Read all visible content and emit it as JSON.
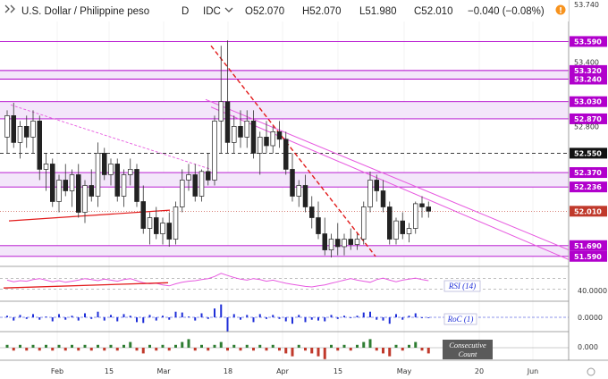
{
  "header": {
    "symbol": "U.S. Dollar / Philippine peso",
    "interval": "D",
    "exchange": "IDC",
    "open": "O52.070",
    "high": "H52.070",
    "low": "L51.980",
    "close": "C52.010",
    "change": "−0.040 (−0.08%)",
    "chevron_icon": "chevron-down-icon",
    "alert_icon": "exclamation-badge-icon"
  },
  "colors": {
    "bull": "#2e7d32",
    "bear": "#c0392b",
    "zone_fill": "#f3e6fa",
    "zone_line": "#b100cc",
    "channel": "#e75ae0",
    "trend_red": "#e21b1b",
    "price_tag": "#222222",
    "rsi_line": "#e75ae0",
    "roc_bar": "#1f2fd8"
  },
  "chart_data": {
    "type": "candlestick",
    "title": "U.S. Dollar / Philippine peso",
    "x_labels": [
      "Feb",
      "15",
      "Mar",
      "18",
      "Apr",
      "15",
      "May",
      "20",
      "Jun"
    ],
    "y_labels": [
      "53.740",
      "53.590",
      "53.400",
      "53.320",
      "53.240",
      "53.030",
      "52.870",
      "52.800",
      "52.550",
      "52.370",
      "52.236",
      "52.010",
      "51.690",
      "51.590"
    ],
    "ylim": [
      51.48,
      53.76
    ],
    "last_price": 52.01,
    "ohlc": [
      [
        52.7,
        52.95,
        52.55,
        52.9
      ],
      [
        52.9,
        53.02,
        52.6,
        52.65
      ],
      [
        52.65,
        52.85,
        52.5,
        52.8
      ],
      [
        52.8,
        52.9,
        52.6,
        52.7
      ],
      [
        52.7,
        52.95,
        52.55,
        52.85
      ],
      [
        52.85,
        52.9,
        52.3,
        52.4
      ],
      [
        52.4,
        52.55,
        52.2,
        52.45
      ],
      [
        52.45,
        52.5,
        52.05,
        52.1
      ],
      [
        52.1,
        52.35,
        52.0,
        52.3
      ],
      [
        52.3,
        52.45,
        52.15,
        52.2
      ],
      [
        52.2,
        52.4,
        52.05,
        52.35
      ],
      [
        52.35,
        52.45,
        51.95,
        52.0
      ],
      [
        52.0,
        52.3,
        51.9,
        52.25
      ],
      [
        52.25,
        52.4,
        52.1,
        52.15
      ],
      [
        52.15,
        52.65,
        52.05,
        52.55
      ],
      [
        52.55,
        52.6,
        52.3,
        52.35
      ],
      [
        52.35,
        52.5,
        52.25,
        52.45
      ],
      [
        52.45,
        52.5,
        52.1,
        52.15
      ],
      [
        52.15,
        52.4,
        52.05,
        52.35
      ],
      [
        52.35,
        52.5,
        52.25,
        52.4
      ],
      [
        52.4,
        52.45,
        52.05,
        52.1
      ],
      [
        52.1,
        52.25,
        51.8,
        51.85
      ],
      [
        51.85,
        52.0,
        51.7,
        51.95
      ],
      [
        51.95,
        52.05,
        51.75,
        51.8
      ],
      [
        51.8,
        51.95,
        51.7,
        51.9
      ],
      [
        51.9,
        52.0,
        51.68,
        51.75
      ],
      [
        51.75,
        52.1,
        51.7,
        52.05
      ],
      [
        52.05,
        52.4,
        52.0,
        52.3
      ],
      [
        52.3,
        52.45,
        52.2,
        52.35
      ],
      [
        52.35,
        52.45,
        52.1,
        52.15
      ],
      [
        52.15,
        52.4,
        52.1,
        52.38
      ],
      [
        52.38,
        52.55,
        52.25,
        52.3
      ],
      [
        52.3,
        52.9,
        52.25,
        52.85
      ],
      [
        52.85,
        53.55,
        52.55,
        53.03
      ],
      [
        53.03,
        53.6,
        52.55,
        52.65
      ],
      [
        52.65,
        52.9,
        52.55,
        52.8
      ],
      [
        52.8,
        52.95,
        52.6,
        52.7
      ],
      [
        52.7,
        52.95,
        52.6,
        52.85
      ],
      [
        52.85,
        52.95,
        52.5,
        52.55
      ],
      [
        52.55,
        52.75,
        52.35,
        52.7
      ],
      [
        52.7,
        52.85,
        52.55,
        52.62
      ],
      [
        52.62,
        52.8,
        52.55,
        52.75
      ],
      [
        52.75,
        52.85,
        52.6,
        52.68
      ],
      [
        52.68,
        52.75,
        52.35,
        52.4
      ],
      [
        52.4,
        52.55,
        52.1,
        52.15
      ],
      [
        52.15,
        52.3,
        52.05,
        52.25
      ],
      [
        52.25,
        52.35,
        52.0,
        52.05
      ],
      [
        52.05,
        52.15,
        51.85,
        51.95
      ],
      [
        51.95,
        52.1,
        51.75,
        51.8
      ],
      [
        51.8,
        51.95,
        51.6,
        51.65
      ],
      [
        51.65,
        51.8,
        51.58,
        51.75
      ],
      [
        51.75,
        51.9,
        51.6,
        51.68
      ],
      [
        51.68,
        51.8,
        51.6,
        51.75
      ],
      [
        51.75,
        51.85,
        51.65,
        51.7
      ],
      [
        51.7,
        51.8,
        51.65,
        51.75
      ],
      [
        51.75,
        52.1,
        51.7,
        52.05
      ],
      [
        52.05,
        52.38,
        52.0,
        52.3
      ],
      [
        52.3,
        52.35,
        52.1,
        52.2
      ],
      [
        52.2,
        52.3,
        52.0,
        52.05
      ],
      [
        52.05,
        52.1,
        51.7,
        51.75
      ],
      [
        51.75,
        51.95,
        51.7,
        51.92
      ],
      [
        51.92,
        52.0,
        51.75,
        51.8
      ],
      [
        51.8,
        51.9,
        51.72,
        51.85
      ],
      [
        51.85,
        52.1,
        51.8,
        52.08
      ],
      [
        52.08,
        52.15,
        51.95,
        52.05
      ],
      [
        52.05,
        52.1,
        51.95,
        52.01
      ]
    ],
    "horizontal_levels": [
      53.59,
      53.32,
      53.24,
      53.03,
      52.87,
      52.37,
      52.236,
      51.69,
      51.59
    ],
    "dashed_level": 52.55,
    "zones": [
      [
        53.24,
        53.32
      ],
      [
        52.87,
        53.03
      ],
      [
        52.236,
        52.37
      ],
      [
        51.59,
        51.69
      ]
    ],
    "indicators": [
      {
        "name": "RSI (14)",
        "level_label": "40.0000",
        "values": [
          57,
          54,
          56,
          55,
          58,
          60,
          57,
          54,
          56,
          53,
          55,
          57,
          60,
          58,
          56,
          59,
          57,
          55,
          58,
          60,
          56,
          52,
          50,
          51,
          48,
          46,
          50,
          53,
          55,
          56,
          58,
          60,
          64,
          70,
          66,
          62,
          59,
          57,
          60,
          58,
          55,
          57,
          54,
          51,
          49,
          47,
          45,
          44,
          46,
          48,
          51,
          54,
          57,
          60,
          57,
          55,
          53,
          58,
          61,
          57,
          54,
          57,
          59,
          61,
          58,
          56
        ]
      },
      {
        "name": "RoC (1)",
        "level_label": "0.0000",
        "values": [
          2,
          -4,
          3,
          -2,
          4,
          -3,
          1,
          -5,
          4,
          -3,
          2,
          -4,
          5,
          -2,
          7,
          -4,
          3,
          -5,
          4,
          2,
          -6,
          -7,
          3,
          -4,
          2,
          -3,
          7,
          6,
          1,
          -4,
          5,
          -2,
          11,
          16,
          -18,
          4,
          -3,
          3,
          -6,
          4,
          -2,
          3,
          -2,
          -5,
          -8,
          3,
          -6,
          -3,
          -4,
          -5,
          3,
          -2,
          2,
          -1,
          2,
          6,
          7,
          -3,
          -4,
          -8,
          4,
          -3,
          2,
          5,
          -1,
          -1
        ]
      },
      {
        "name": "Consecutive Count",
        "level_label": "0.000",
        "values": [
          1,
          -1,
          1,
          -1,
          1,
          -1,
          1,
          -1,
          1,
          -1,
          1,
          -1,
          1,
          -1,
          1,
          -1,
          1,
          -1,
          1,
          2,
          -1,
          -2,
          1,
          -1,
          1,
          -1,
          1,
          2,
          3,
          -1,
          1,
          -1,
          1,
          2,
          -1,
          1,
          -1,
          1,
          -1,
          1,
          -1,
          1,
          -1,
          -2,
          -3,
          1,
          -1,
          -2,
          -3,
          -4,
          1,
          -1,
          1,
          -1,
          1,
          2,
          3,
          -1,
          -2,
          -3,
          1,
          -1,
          1,
          2,
          -1,
          -2
        ]
      }
    ]
  }
}
